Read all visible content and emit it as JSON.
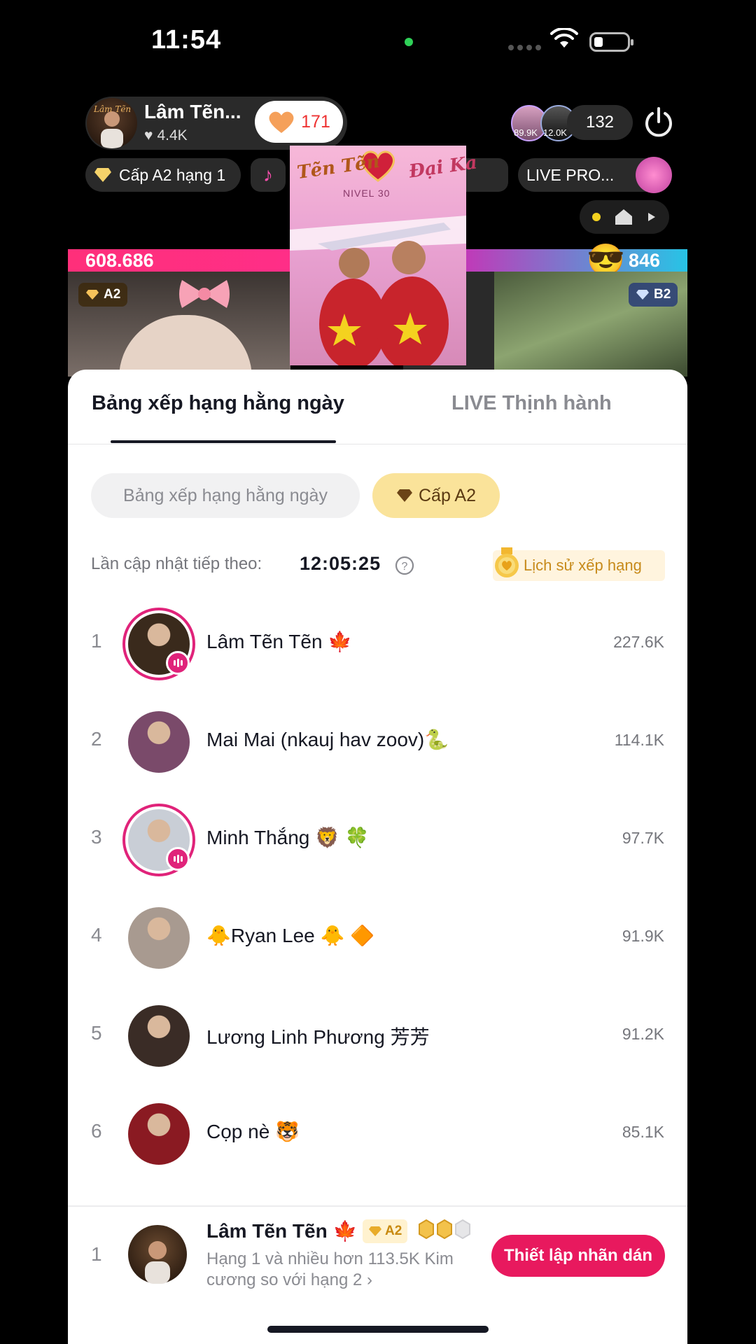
{
  "status_bar": {
    "time": "11:54"
  },
  "host": {
    "name": "Lâm Tẽn...",
    "likes": "4.4K",
    "follow_count": "171"
  },
  "viewers": {
    "avatar1_badge": "89.9K",
    "avatar2_badge": "12.0K",
    "count": "132"
  },
  "chips": {
    "rank": "Cấp A2 hạng 1",
    "promo": "LIVE PRO..."
  },
  "battle": {
    "score_left": "608.686",
    "score_right": "846",
    "emoji": "😎"
  },
  "video_badges": {
    "left": "A2",
    "right": "B2"
  },
  "poster": {
    "title_left": "Tẽn Tẽn",
    "title_right": "Đại Ka",
    "subtitle": "NIVEL 30"
  },
  "sheet": {
    "tabs": [
      "Bảng xếp hạng hằng ngày",
      "LIVE Thịnh hành"
    ],
    "filter_chips": [
      "Bảng xếp hạng hằng ngày",
      "Cấp A2"
    ],
    "update_label": "Lần cập nhật tiếp theo:",
    "update_time": "12:05:25",
    "history_label": "Lịch sử xếp hạng",
    "rows": [
      {
        "rank": "1",
        "name": "Lâm Tẽn Tẽn 🍁",
        "score": "227.6K",
        "live": true,
        "color": "#3a2a1c"
      },
      {
        "rank": "2",
        "name": "Mai Mai (nkauj hav zoov)🐍",
        "score": "114.1K",
        "live": false,
        "color": "#7a4a6a"
      },
      {
        "rank": "3",
        "name": "Minh Thắng 🦁 🍀",
        "score": "97.7K",
        "live": true,
        "color": "#c9ced6"
      },
      {
        "rank": "4",
        "name": "🐥Ryan Lee 🐥 🔶",
        "score": "91.9K",
        "live": false,
        "color": "#a89a90"
      },
      {
        "rank": "5",
        "name": "Lương Linh Phương 芳芳",
        "score": "91.2K",
        "live": false,
        "color": "#3a2c26"
      },
      {
        "rank": "6",
        "name": "Cọp nè 🐯",
        "score": "85.1K",
        "live": false,
        "color": "#8a1a22"
      }
    ]
  },
  "self_card": {
    "rank": "1",
    "name": "Lâm Tẽn Tẽn 🍁",
    "level": "A2",
    "description": "Hạng 1 và nhiều hơn 113.5K Kim cương so với hạng 2  ›",
    "button": "Thiết lập nhãn dán"
  },
  "colors": {
    "accent": "#e8195e",
    "live_ring": "#e0237a",
    "level_chip": "#fae39a"
  }
}
